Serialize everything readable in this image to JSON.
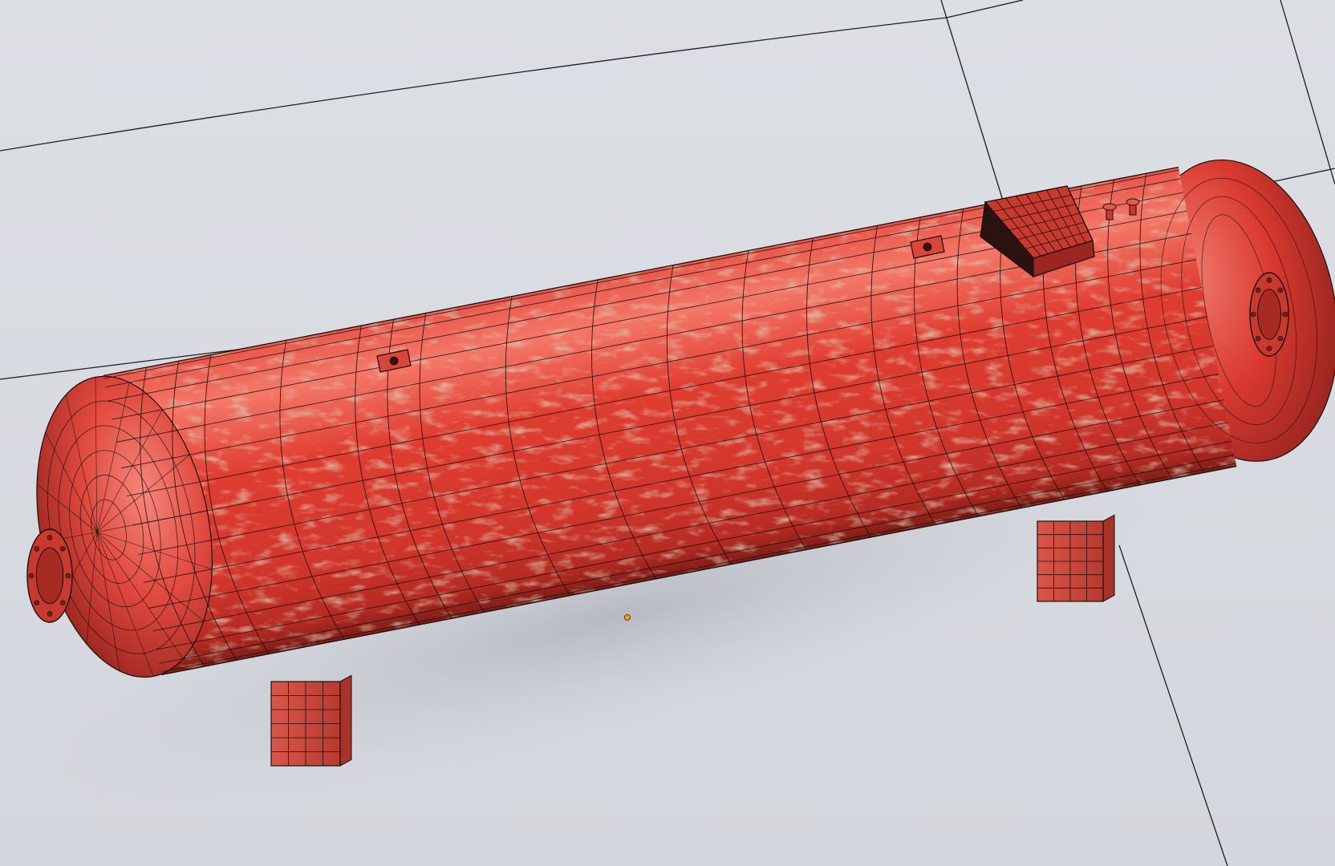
{
  "scene": {
    "subject": "tank-model",
    "colors": {
      "background": "#d9dce1",
      "tank_paint": "#d9302a",
      "tank_highlight": "#f26a5c",
      "tank_shadow": "#8e1f1a",
      "rust": "#b98a6a",
      "wire": "#1a0f0e",
      "ground_lines": "#222222"
    },
    "view_mode": "wireframe-over-shaded"
  }
}
